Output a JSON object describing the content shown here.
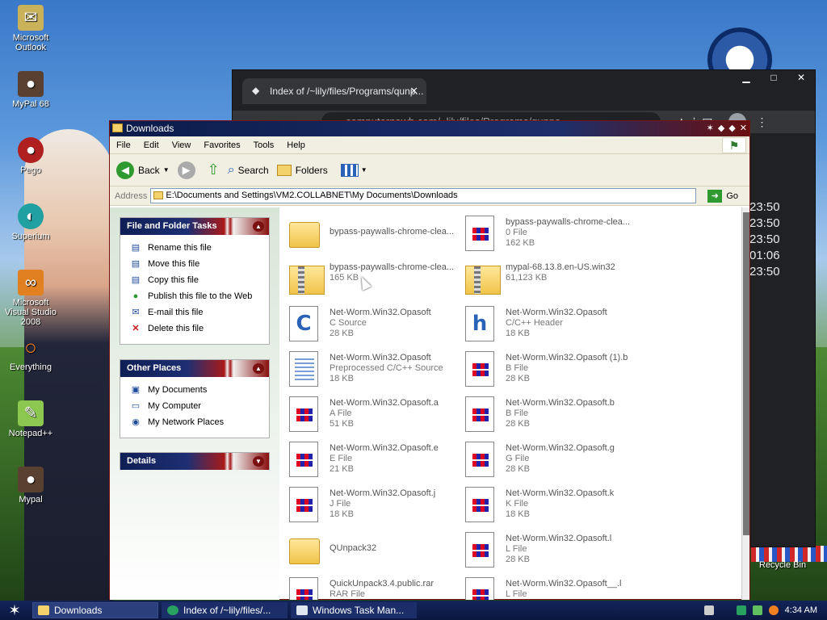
{
  "desktop": {
    "icons": [
      {
        "label": "Microsoft Outlook",
        "icon": "outlook-icon"
      },
      {
        "label": "MyPal 68",
        "icon": "mypal-icon"
      },
      {
        "label": "Pego",
        "icon": "pego-icon"
      },
      {
        "label": "Superium",
        "icon": "superium-icon"
      },
      {
        "label": "Microsoft Visual Studio 2008",
        "icon": "visual-studio-icon"
      },
      {
        "label": "Everything",
        "icon": "everything-icon"
      },
      {
        "label": "Notepad++",
        "icon": "notepadpp-icon"
      },
      {
        "label": "Mypal",
        "icon": "mypal-icon"
      }
    ],
    "recycle_bin": "Recycle Bin"
  },
  "browser": {
    "tab_title": "Index of /~lily/files/Programs/qunp...",
    "url": "computernewb.com/~lily/files/Programs/qunpa",
    "times": [
      "23:50",
      "23:50",
      "23:50",
      "01:06",
      "23:50"
    ]
  },
  "explorer": {
    "title": "Downloads",
    "menu": [
      "File",
      "Edit",
      "View",
      "Favorites",
      "Tools",
      "Help"
    ],
    "toolbar": {
      "back": "Back",
      "search": "Search",
      "folders": "Folders"
    },
    "address_label": "Address",
    "address": "E:\\Documents and Settings\\VM2.COLLABNET\\My Documents\\Downloads",
    "go": "Go",
    "file_tasks": {
      "title": "File and Folder Tasks",
      "items": [
        "Rename this file",
        "Move this file",
        "Copy this file",
        "Publish this file to the Web",
        "E-mail this file",
        "Delete this file"
      ]
    },
    "other_places": {
      "title": "Other Places",
      "items": [
        "My Documents",
        "My Computer",
        "My Network Places"
      ]
    },
    "details": {
      "title": "Details"
    },
    "files": [
      {
        "name": "bypass-paywalls-chrome-clea...",
        "type": "",
        "size": "",
        "kind": "folder"
      },
      {
        "name": "bypass-paywalls-chrome-clea...",
        "type": "0 File",
        "size": "162 KB",
        "kind": "generic"
      },
      {
        "name": "bypass-paywalls-chrome-clea...",
        "type": "165 KB",
        "size": "",
        "kind": "zip"
      },
      {
        "name": "mypal-68.13.8.en-US.win32",
        "type": "61,123 KB",
        "size": "",
        "kind": "zip"
      },
      {
        "name": "Net-Worm.Win32.Opasoft",
        "type": "C Source",
        "size": "28 KB",
        "kind": "c"
      },
      {
        "name": "Net-Worm.Win32.Opasoft",
        "type": "C/C++ Header",
        "size": "18 KB",
        "kind": "h"
      },
      {
        "name": "Net-Worm.Win32.Opasoft",
        "type": "Preprocessed C/C++ Source",
        "size": "18 KB",
        "kind": "text"
      },
      {
        "name": "Net-Worm.Win32.Opasoft (1).b",
        "type": "B File",
        "size": "28 KB",
        "kind": "generic"
      },
      {
        "name": "Net-Worm.Win32.Opasoft.a",
        "type": "A File",
        "size": "51 KB",
        "kind": "generic"
      },
      {
        "name": "Net-Worm.Win32.Opasoft.b",
        "type": "B File",
        "size": "28 KB",
        "kind": "generic"
      },
      {
        "name": "Net-Worm.Win32.Opasoft.e",
        "type": "E File",
        "size": "21 KB",
        "kind": "generic"
      },
      {
        "name": "Net-Worm.Win32.Opasoft.g",
        "type": "G File",
        "size": "28 KB",
        "kind": "generic"
      },
      {
        "name": "Net-Worm.Win32.Opasoft.j",
        "type": "J File",
        "size": "18 KB",
        "kind": "generic"
      },
      {
        "name": "Net-Worm.Win32.Opasoft.k",
        "type": "K File",
        "size": "18 KB",
        "kind": "generic"
      },
      {
        "name": "QUnpack32",
        "type": "",
        "size": "",
        "kind": "folder"
      },
      {
        "name": "Net-Worm.Win32.Opasoft.l",
        "type": "L File",
        "size": "28 KB",
        "kind": "generic"
      },
      {
        "name": "QuickUnpack3.4.public.rar",
        "type": "RAR File",
        "size": "",
        "kind": "generic"
      },
      {
        "name": "Net-Worm.Win32.Opasoft__.l",
        "type": "L File",
        "size": "",
        "kind": "generic"
      }
    ]
  },
  "taskbar": {
    "buttons": [
      "Downloads",
      "Index of /~lily/files/...",
      "Windows Task Man..."
    ],
    "clock": "4:34 AM"
  }
}
